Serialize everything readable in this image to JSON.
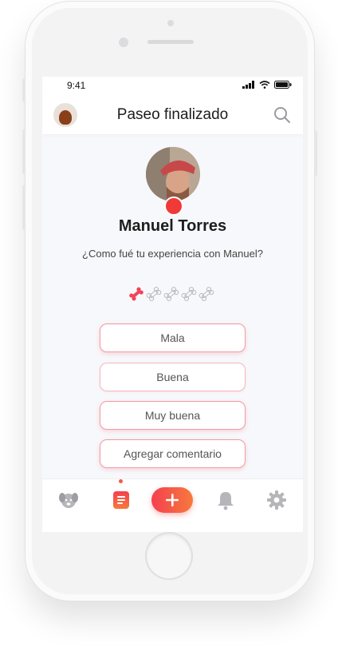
{
  "status_bar": {
    "time": "9:41"
  },
  "header": {
    "title": "Paseo finalizado"
  },
  "profile": {
    "name": "Manuel Torres",
    "question": "¿Como fué tu experiencia con Manuel?"
  },
  "rating": {
    "value": 1,
    "max": 5,
    "active_color": "#f0455c",
    "inactive_color": "#b9b9be"
  },
  "options": [
    {
      "label": "Mala"
    },
    {
      "label": "Buena"
    },
    {
      "label": "Muy buena"
    },
    {
      "label": "Agregar comentario"
    }
  ],
  "tabbar": {
    "tabs": [
      {
        "icon": "dog-icon"
      },
      {
        "icon": "list-icon",
        "active": true
      },
      {
        "icon": "plus-icon"
      },
      {
        "icon": "bell-icon"
      },
      {
        "icon": "gear-icon"
      }
    ]
  },
  "colors": {
    "accent": "#f0455c",
    "accent_gradient_end": "#f7793d"
  }
}
